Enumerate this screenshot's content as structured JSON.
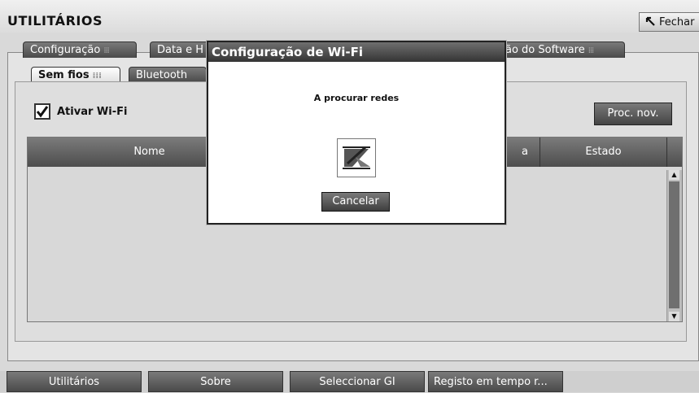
{
  "app": {
    "title": "UTILITÁRIOS",
    "close_label": "Fechar"
  },
  "tabs": [
    {
      "label": "Configuração"
    },
    {
      "label": "Data e H"
    },
    {
      "label": "ão do Software"
    }
  ],
  "subtabs": [
    {
      "label": "Sem fios"
    },
    {
      "label": "Bluetooth"
    }
  ],
  "wifi": {
    "checkbox_label": "Ativar Wi-Fi",
    "checked": true,
    "scan_button": "Proc. nov."
  },
  "table": {
    "columns": [
      "Nome",
      "a",
      "Estado"
    ],
    "rows": []
  },
  "modal": {
    "title": "Configuração de Wi-Fi",
    "message": "A procurar redes",
    "cancel_label": "Cancelar",
    "icon": "hourglass-icon"
  },
  "bottom_nav": [
    {
      "label": "Utilitários"
    },
    {
      "label": "Sobre"
    },
    {
      "label": "Seleccionar GI"
    },
    {
      "label": "Registo em tempo r..."
    }
  ]
}
